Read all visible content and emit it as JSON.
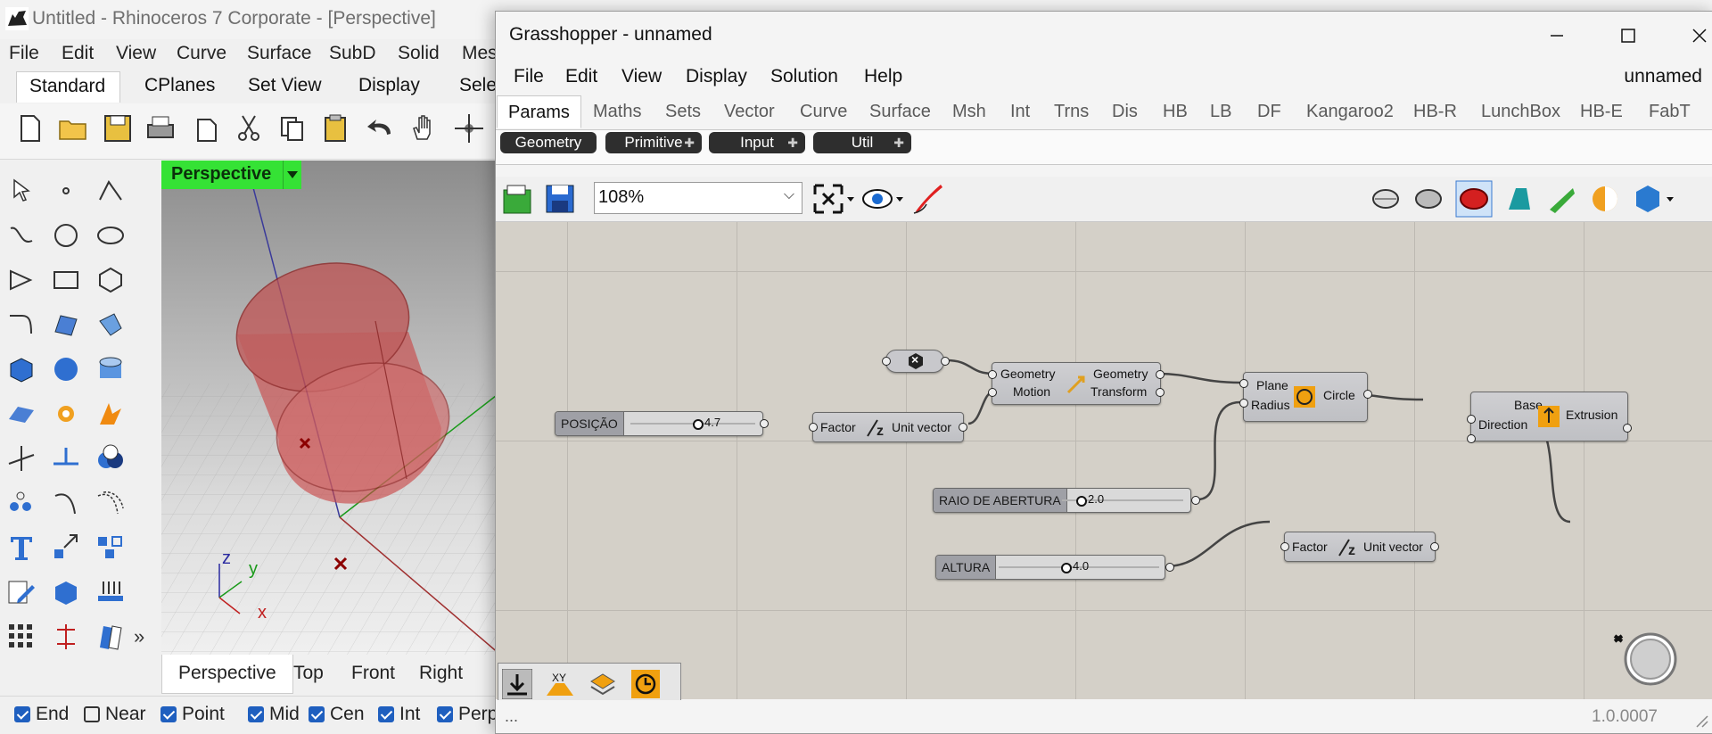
{
  "rhino": {
    "title": "Untitled - Rhinoceros 7 Corporate - [Perspective]",
    "menu": [
      "File",
      "Edit",
      "View",
      "Curve",
      "Surface",
      "SubD",
      "Solid",
      "Mes"
    ],
    "tabs": [
      "Standard",
      "CPlanes",
      "Set View",
      "Display",
      "Sele"
    ],
    "viewport": {
      "name": "Perspective",
      "tabs": [
        "Perspective",
        "Top",
        "Front",
        "Right"
      ],
      "axis": {
        "x": "x",
        "y": "y",
        "z": "z"
      }
    },
    "osnaps": [
      {
        "label": "End",
        "checked": true
      },
      {
        "label": "Near",
        "checked": false
      },
      {
        "label": "Point",
        "checked": true
      },
      {
        "label": "Mid",
        "checked": true
      },
      {
        "label": "Cen",
        "checked": true
      },
      {
        "label": "Int",
        "checked": true
      },
      {
        "label": "Perp",
        "checked": true
      }
    ],
    "overflow": "»"
  },
  "gh": {
    "title": "Grasshopper - unnamed",
    "menu": [
      "File",
      "Edit",
      "View",
      "Display",
      "Solution",
      "Help"
    ],
    "doc_name": "unnamed",
    "tabs": [
      "Params",
      "Maths",
      "Sets",
      "Vector",
      "Curve",
      "Surface",
      "Msh",
      "Int",
      "Trns",
      "Dis",
      "HB",
      "LB",
      "DF",
      "Kangaroo2",
      "HB-R",
      "LunchBox",
      "HB-E",
      "FabT"
    ],
    "subtabs": [
      "Geometry",
      "Primitive",
      "Input",
      "Util"
    ],
    "zoom": "108%",
    "status_left": "...",
    "version": "1.0.0007",
    "components": {
      "geo_param": {
        "glyph": "×"
      },
      "move": {
        "in1": "Geometry",
        "in2": "Motion",
        "out1": "Geometry",
        "out2": "Transform"
      },
      "circle": {
        "in1": "Plane",
        "in2": "Radius",
        "out": "Circle"
      },
      "extrusion": {
        "in1": "Base",
        "in2": "Direction",
        "out": "Extrusion"
      },
      "unitz1": {
        "in": "Factor",
        "out": "Unit vector"
      },
      "unitz2": {
        "in": "Factor",
        "out": "Unit vector"
      },
      "slider_pos": {
        "name": "POSIÇÃO",
        "value": "4.7"
      },
      "slider_raio": {
        "name": "RAIO DE ABERTURA",
        "value": "2.0"
      },
      "slider_alt": {
        "name": "ALTURA",
        "value": "4.0"
      }
    }
  }
}
